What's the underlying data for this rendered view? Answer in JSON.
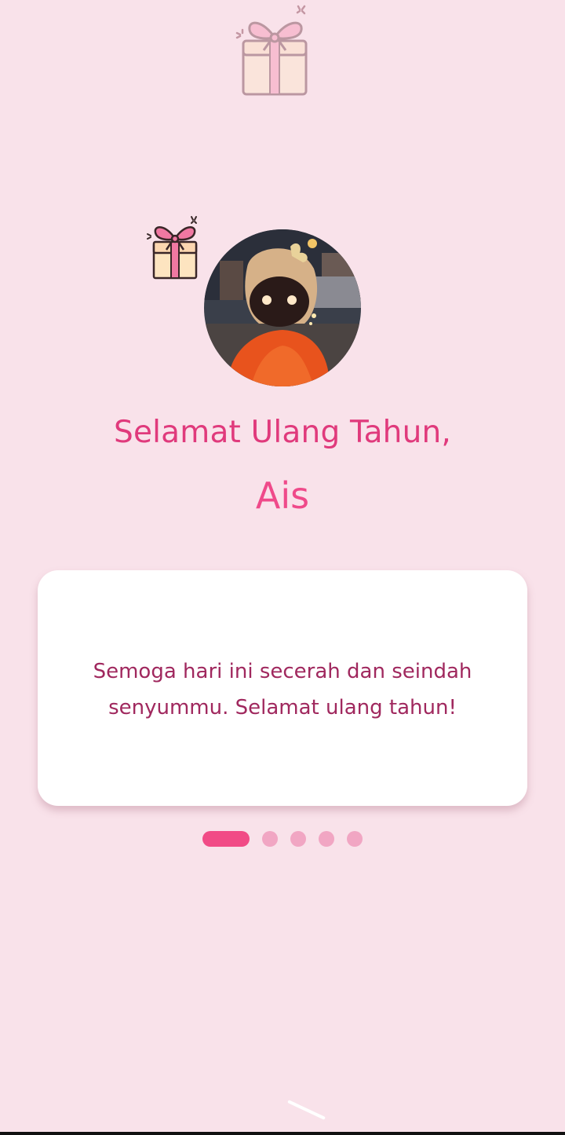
{
  "greeting": {
    "title": "Selamat Ulang Tahun,",
    "name": "Ais"
  },
  "card": {
    "message": "Semoga hari ini secerah dan seindah senyummu. Selamat ulang tahun!"
  },
  "pager": {
    "total_pages": 5,
    "current_page": 1
  },
  "icons": {
    "top": "gift-icon",
    "side": "gift-icon"
  },
  "colors": {
    "background": "#f9e2ea",
    "title": "#e03a7c",
    "name": "#ef4a8a",
    "message": "#a0285e",
    "dot_active": "#f14b86",
    "dot_inactive": "#f1a6c3"
  }
}
